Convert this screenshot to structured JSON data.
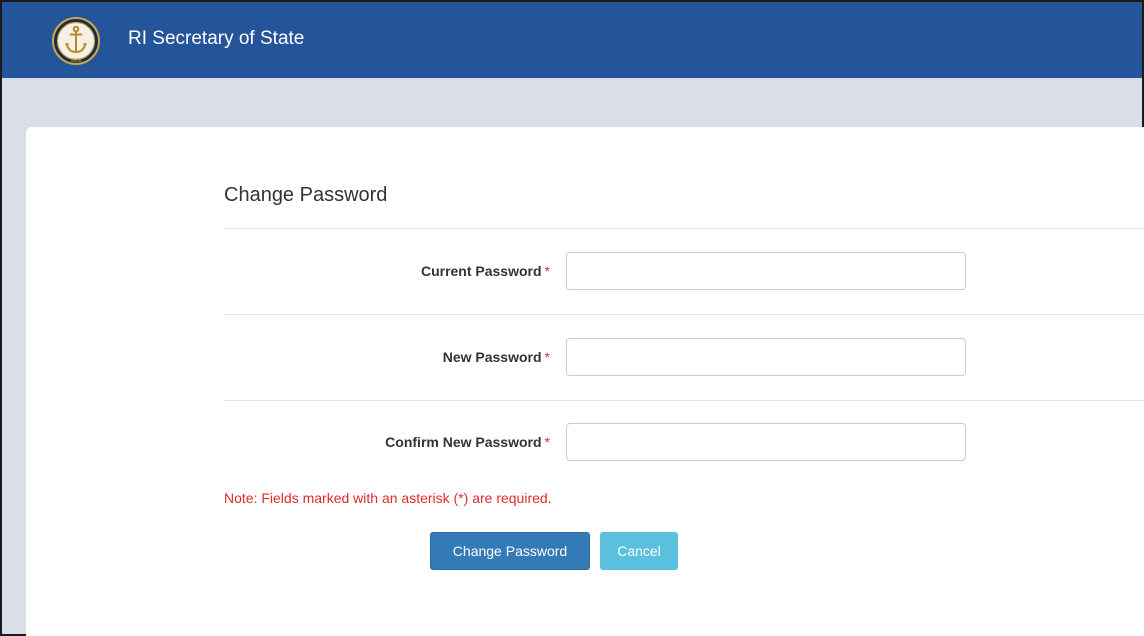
{
  "header": {
    "brand": "RI Secretary of State",
    "logo_text": "1636",
    "logo_icon": "anchor-seal-icon"
  },
  "form": {
    "title": "Change Password",
    "fields": [
      {
        "label": "Current Password",
        "required_mark": "*",
        "value": "",
        "placeholder": ""
      },
      {
        "label": "New Password",
        "required_mark": "*",
        "value": "",
        "placeholder": ""
      },
      {
        "label": "Confirm New Password",
        "required_mark": "*",
        "value": "",
        "placeholder": ""
      }
    ],
    "note": "Note: Fields marked with an asterisk (*) are required.",
    "submit_label": "Change Password",
    "cancel_label": "Cancel"
  },
  "colors": {
    "header_bg": "#24549a",
    "primary": "#337ab7",
    "cancel": "#5bc0de",
    "required": "#e02b2b"
  }
}
